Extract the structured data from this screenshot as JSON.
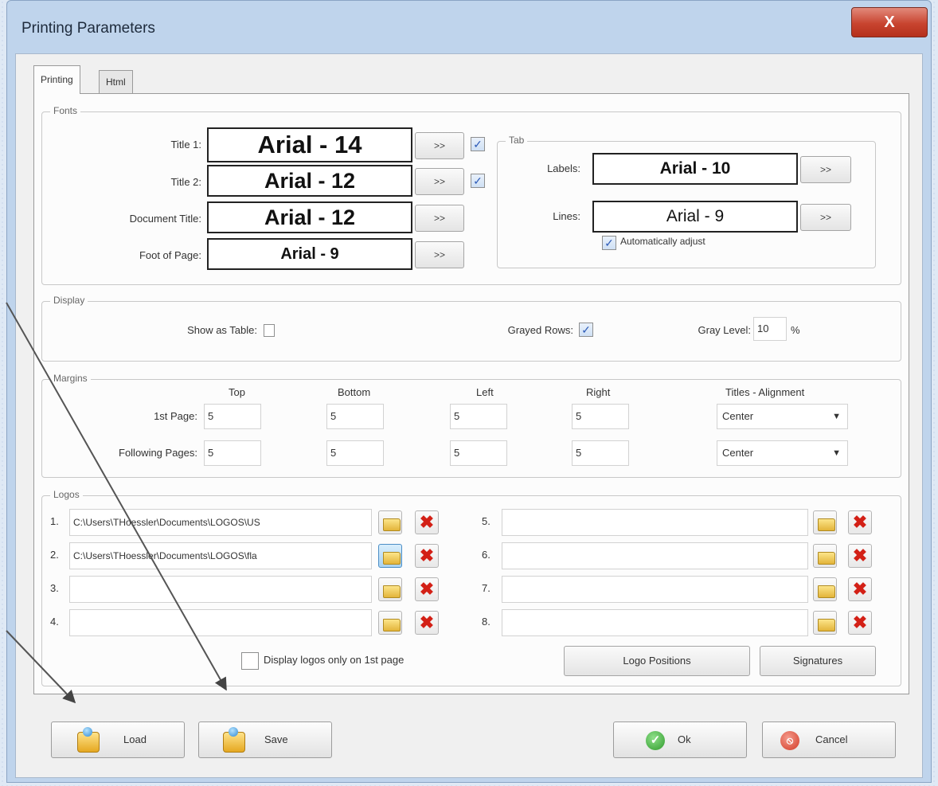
{
  "window": {
    "title": "Printing Parameters",
    "close_glyph": "X"
  },
  "tabs": [
    {
      "label": "Printing",
      "active": true
    },
    {
      "label": "Html",
      "active": false
    }
  ],
  "fonts": {
    "legend": "Fonts",
    "rows": [
      {
        "label": "Title 1:",
        "font": "Arial - 14",
        "button": ">>",
        "checked": true
      },
      {
        "label": "Title 2:",
        "font": "Arial - 12",
        "button": ">>",
        "checked": true
      },
      {
        "label": "Document Title:",
        "font": "Arial - 12",
        "button": ">>"
      },
      {
        "label": "Foot of Page:",
        "font": "Arial - 9",
        "button": ">>"
      }
    ],
    "tab_group": {
      "legend": "Tab",
      "labels": {
        "label": "Labels:",
        "font": "Arial - 10",
        "button": ">>"
      },
      "lines": {
        "label": "Lines:",
        "font": "Arial - 9",
        "button": ">>"
      },
      "auto_adjust": {
        "label": "Automatically adjust",
        "checked": true
      }
    }
  },
  "display": {
    "legend": "Display",
    "show_as_table": {
      "label": "Show as Table:",
      "checked": false
    },
    "grayed_rows": {
      "label": "Grayed Rows:",
      "checked": true
    },
    "gray_level": {
      "label": "Gray Level:",
      "value": "10",
      "unit": "%"
    }
  },
  "margins": {
    "legend": "Margins",
    "columns": [
      "Top",
      "Bottom",
      "Left",
      "Right",
      "Titles - Alignment"
    ],
    "rows": [
      {
        "label": "1st Page:",
        "top": "5",
        "bottom": "5",
        "left": "5",
        "right": "5",
        "alignment": "Center"
      },
      {
        "label": "Following Pages:",
        "top": "5",
        "bottom": "5",
        "left": "5",
        "right": "5",
        "alignment": "Center"
      }
    ]
  },
  "logos": {
    "legend": "Logos",
    "items": [
      {
        "num": "1.",
        "path": "C:\\Users\\THoessler\\Documents\\LOGOS\\US"
      },
      {
        "num": "2.",
        "path": "C:\\Users\\THoessler\\Documents\\LOGOS\\fla"
      },
      {
        "num": "3.",
        "path": ""
      },
      {
        "num": "4.",
        "path": ""
      },
      {
        "num": "5.",
        "path": ""
      },
      {
        "num": "6.",
        "path": ""
      },
      {
        "num": "7.",
        "path": ""
      },
      {
        "num": "8.",
        "path": ""
      }
    ],
    "only_first_page": {
      "label": "Display logos only on 1st page",
      "checked": false
    },
    "logo_positions_label": "Logo Positions",
    "signatures_label": "Signatures"
  },
  "footer": {
    "load_label": "Load",
    "save_label": "Save",
    "ok_label": "Ok",
    "cancel_label": "Cancel"
  },
  "icons": {
    "folder": "folder-icon",
    "delete": "delete-icon",
    "load": "disk-icon",
    "save": "disk-icon",
    "ok": "check-icon",
    "cancel": "cancel-icon"
  },
  "colors": {
    "delete_red": "#d32016",
    "ok_green": "#2f9a2b",
    "cancel_red": "#d23a26"
  }
}
